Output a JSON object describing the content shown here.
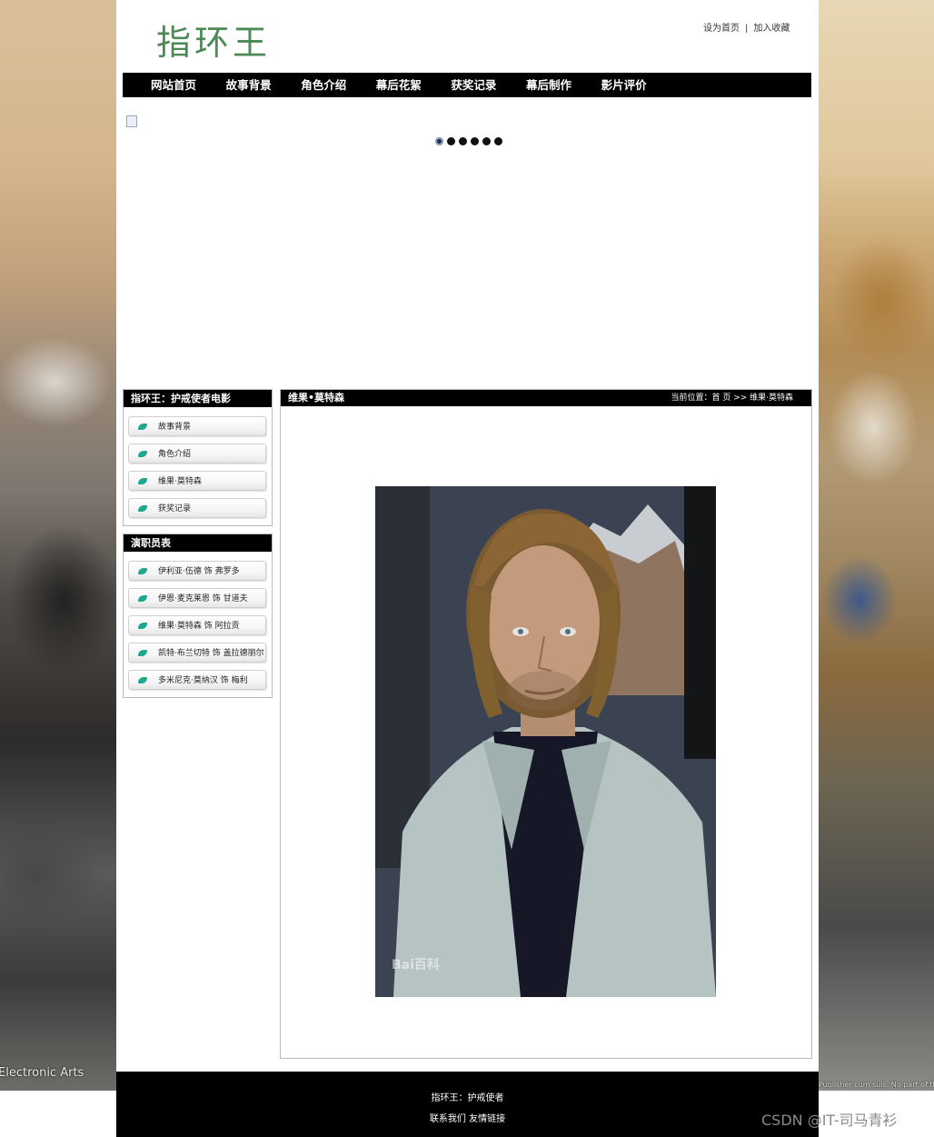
{
  "site": {
    "logo_text": "指环王",
    "top_links": [
      "设为首页",
      "加入收藏"
    ],
    "top_links_separator": "|"
  },
  "nav": {
    "items": [
      "网站首页",
      "故事背景",
      "角色介绍",
      "幕后花絮",
      "获奖记录",
      "幕后制作",
      "影片评价"
    ]
  },
  "slider": {
    "dot_count": 6,
    "active_index": 0
  },
  "sidebar": {
    "box1": {
      "title": "指环王：护戒使者电影",
      "items": [
        "故事背景",
        "角色介绍",
        "维果·莫特森",
        "获奖记录"
      ]
    },
    "box2": {
      "title": "演职员表",
      "items": [
        "伊利亚·伍德 饰 弗罗多",
        "伊恩·麦克莱恩 饰 甘道夫",
        "维果·莫特森 饰 阿拉贡",
        "凯特·布兰切特 饰 盖拉德丽尔",
        "多米尼克·莫纳汉 饰 梅利"
      ]
    }
  },
  "main": {
    "title": "维果•莫特森",
    "breadcrumb": "当前位置：首 页 >> 维果·莫特森",
    "photo_watermark": "Bai百科"
  },
  "footer": {
    "line1": "指环王：护戒使者",
    "links": [
      "联系我们",
      "友情链接"
    ]
  },
  "background": {
    "left_caption": "Electronic Arts",
    "right_caption": "Publisher cum suis. No part of this wall"
  },
  "overlay": {
    "watermark": "CSDN @IT-司马青衫"
  },
  "colors": {
    "logo": "#4b8a55",
    "nav_bg": "#000000",
    "leaf": "#1ea88f"
  }
}
